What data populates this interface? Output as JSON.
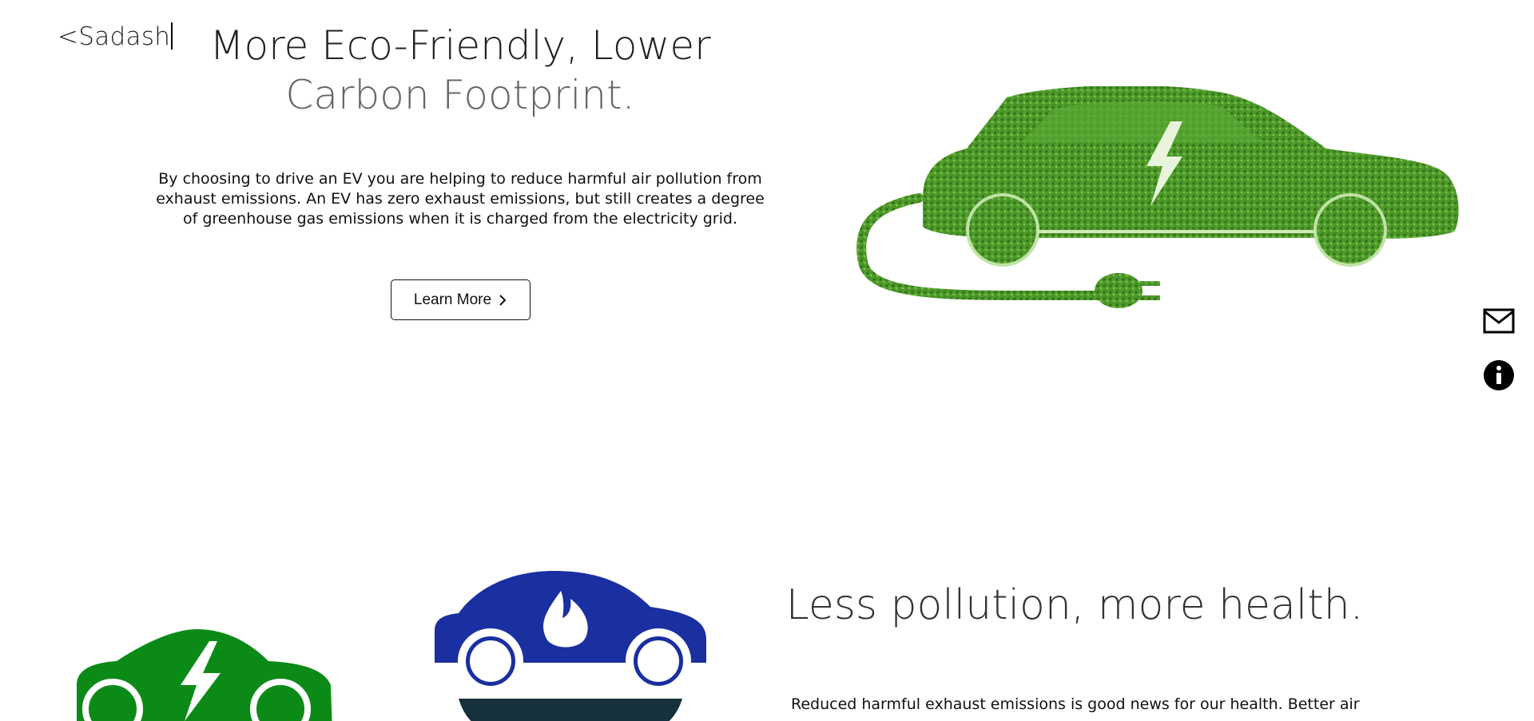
{
  "header": {
    "logo_text": "<Sadash"
  },
  "hero": {
    "title_line1": "More Eco-Friendly, Lower",
    "title_line2": "Carbon Footprint.",
    "body": "By choosing to drive an EV you are helping to reduce harmful air pollution from exhaust emissions. An EV has zero exhaust emissions, but still creates a degree of greenhouse gas emissions when it is charged from the electricity grid.",
    "button_label": "Learn More",
    "image_icon": "grass-electric-car-with-plug"
  },
  "side_actions": {
    "mail_icon": "mail-icon",
    "info_icon": "info-icon"
  },
  "section2": {
    "title": "Less pollution, more health.",
    "body": "Reduced harmful exhaust emissions is good news for our health. Better air"
  },
  "colors": {
    "ev_green": "#0c8a18",
    "gas_blue": "#1a2fa0",
    "dark_base": "#17303d",
    "grass_green": "#4e9a2a"
  }
}
